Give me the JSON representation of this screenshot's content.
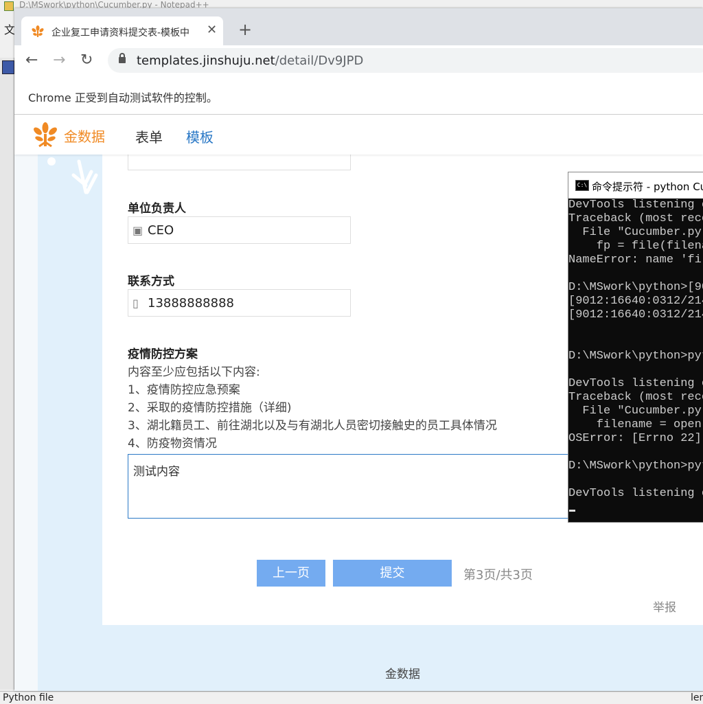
{
  "bg_window": {
    "title": "D:\\MSwork\\python\\Cucumber.py - Notepad++",
    "menu_char": "文",
    "status_left": "Python file",
    "status_right": "len"
  },
  "chrome": {
    "tab_title": "企业复工申请资料提交表-模板中",
    "tab_close": "✕",
    "new_tab": "+",
    "back": "←",
    "forward": "→",
    "reload": "↻",
    "url_host": "templates.jinshuju.net",
    "url_path": "/detail/Dv9JPD",
    "infobar": "Chrome 正受到自动测试软件的控制。"
  },
  "site": {
    "logo_text": "金数据",
    "nav": [
      "表单",
      "模板"
    ],
    "footer": "金数据"
  },
  "form": {
    "fields": [
      {
        "label": "单位负责人",
        "value": "CEO",
        "icon": "id-card-icon"
      },
      {
        "label": "联系方式",
        "value": "13888888888",
        "icon": "phone-icon"
      }
    ],
    "plan": {
      "label": "疫情防控方案",
      "desc": [
        "内容至少应包括以下内容:",
        "1、疫情防控应急预案",
        "2、采取的疫情防控措施（详细)",
        "3、湖北籍员工、前往湖北以及与有湖北人员密切接触史的员工具体情况",
        "4、防疫物资情况"
      ],
      "value": "测试内容"
    },
    "prev_button": "上一页",
    "submit_button": "提交",
    "page_info": "第3页/共3页",
    "report": "举报"
  },
  "cmd": {
    "title": "命令提示符 - python  Cu",
    "icon_text": "C:\\",
    "lines": [
      "DevTools listening o",
      "Traceback (most rece",
      "  File \"Cucumber.py\"",
      "    fp = file(filena",
      "NameError: name 'fil",
      "",
      "D:\\MSwork\\python>[90",
      "[9012:16640:0312/214",
      "[9012:16640:0312/214",
      "",
      "",
      "D:\\MSwork\\python>pyt",
      "",
      "DevTools listening o",
      "Traceback (most rece",
      "  File \"Cucumber.py\"",
      "    filename = open(",
      "OSError: [Errno 22]",
      "",
      "D:\\MSwork\\python>pyt",
      "",
      "DevTools listening o"
    ]
  },
  "colors": {
    "brand": "#f08a24",
    "link": "#2a78c6",
    "button": "#74abf0",
    "band": "#e1f0fb"
  }
}
